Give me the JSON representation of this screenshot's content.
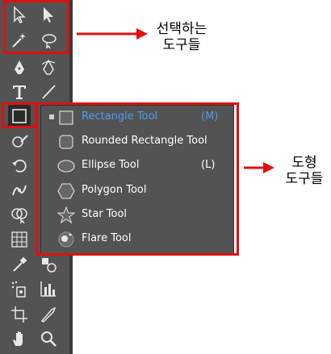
{
  "toolbar": {
    "tools": [
      {
        "name": "selection-tool-icon"
      },
      {
        "name": "direct-selection-tool-icon"
      },
      {
        "name": "magic-wand-tool-icon"
      },
      {
        "name": "lasso-tool-icon"
      },
      {
        "name": "pen-tool-icon"
      },
      {
        "name": "curvature-tool-icon"
      },
      {
        "name": "type-tool-icon"
      },
      {
        "name": "line-segment-tool-icon"
      },
      {
        "name": "rectangle-tool-icon"
      },
      {
        "name": "paintbrush-tool-icon"
      },
      {
        "name": "rotate-tool-icon"
      },
      {
        "name": "width-tool-icon"
      },
      {
        "name": "shape-builder-tool-icon"
      },
      {
        "name": "perspective-grid-tool-icon"
      },
      {
        "name": "eyedropper-tool-icon"
      },
      {
        "name": "symbol-sprayer-tool-icon"
      },
      {
        "name": "column-graph-tool-icon"
      },
      {
        "name": "artboard-tool-icon"
      },
      {
        "name": "slice-tool-icon"
      },
      {
        "name": "hand-tool-icon"
      },
      {
        "name": "zoom-tool-icon"
      }
    ]
  },
  "flyout": {
    "items": [
      {
        "label": "Rectangle Tool",
        "shortcut": "(M)",
        "icon": "rectangle-icon",
        "selected": true
      },
      {
        "label": "Rounded Rectangle Tool",
        "shortcut": "",
        "icon": "rounded-rectangle-icon",
        "selected": false
      },
      {
        "label": "Ellipse Tool",
        "shortcut": "(L)",
        "icon": "ellipse-icon",
        "selected": false
      },
      {
        "label": "Polygon Tool",
        "shortcut": "",
        "icon": "polygon-icon",
        "selected": false
      },
      {
        "label": "Star Tool",
        "shortcut": "",
        "icon": "star-icon",
        "selected": false
      },
      {
        "label": "Flare Tool",
        "shortcut": "",
        "icon": "flare-icon",
        "selected": false
      }
    ]
  },
  "annotations": {
    "selection_tools": "선택하는\n도구들",
    "shape_tools": "도형\n도구들"
  },
  "colors": {
    "toolbar_bg": "#535353",
    "highlight": "#e01010",
    "selected_text": "#4e9cf3"
  }
}
